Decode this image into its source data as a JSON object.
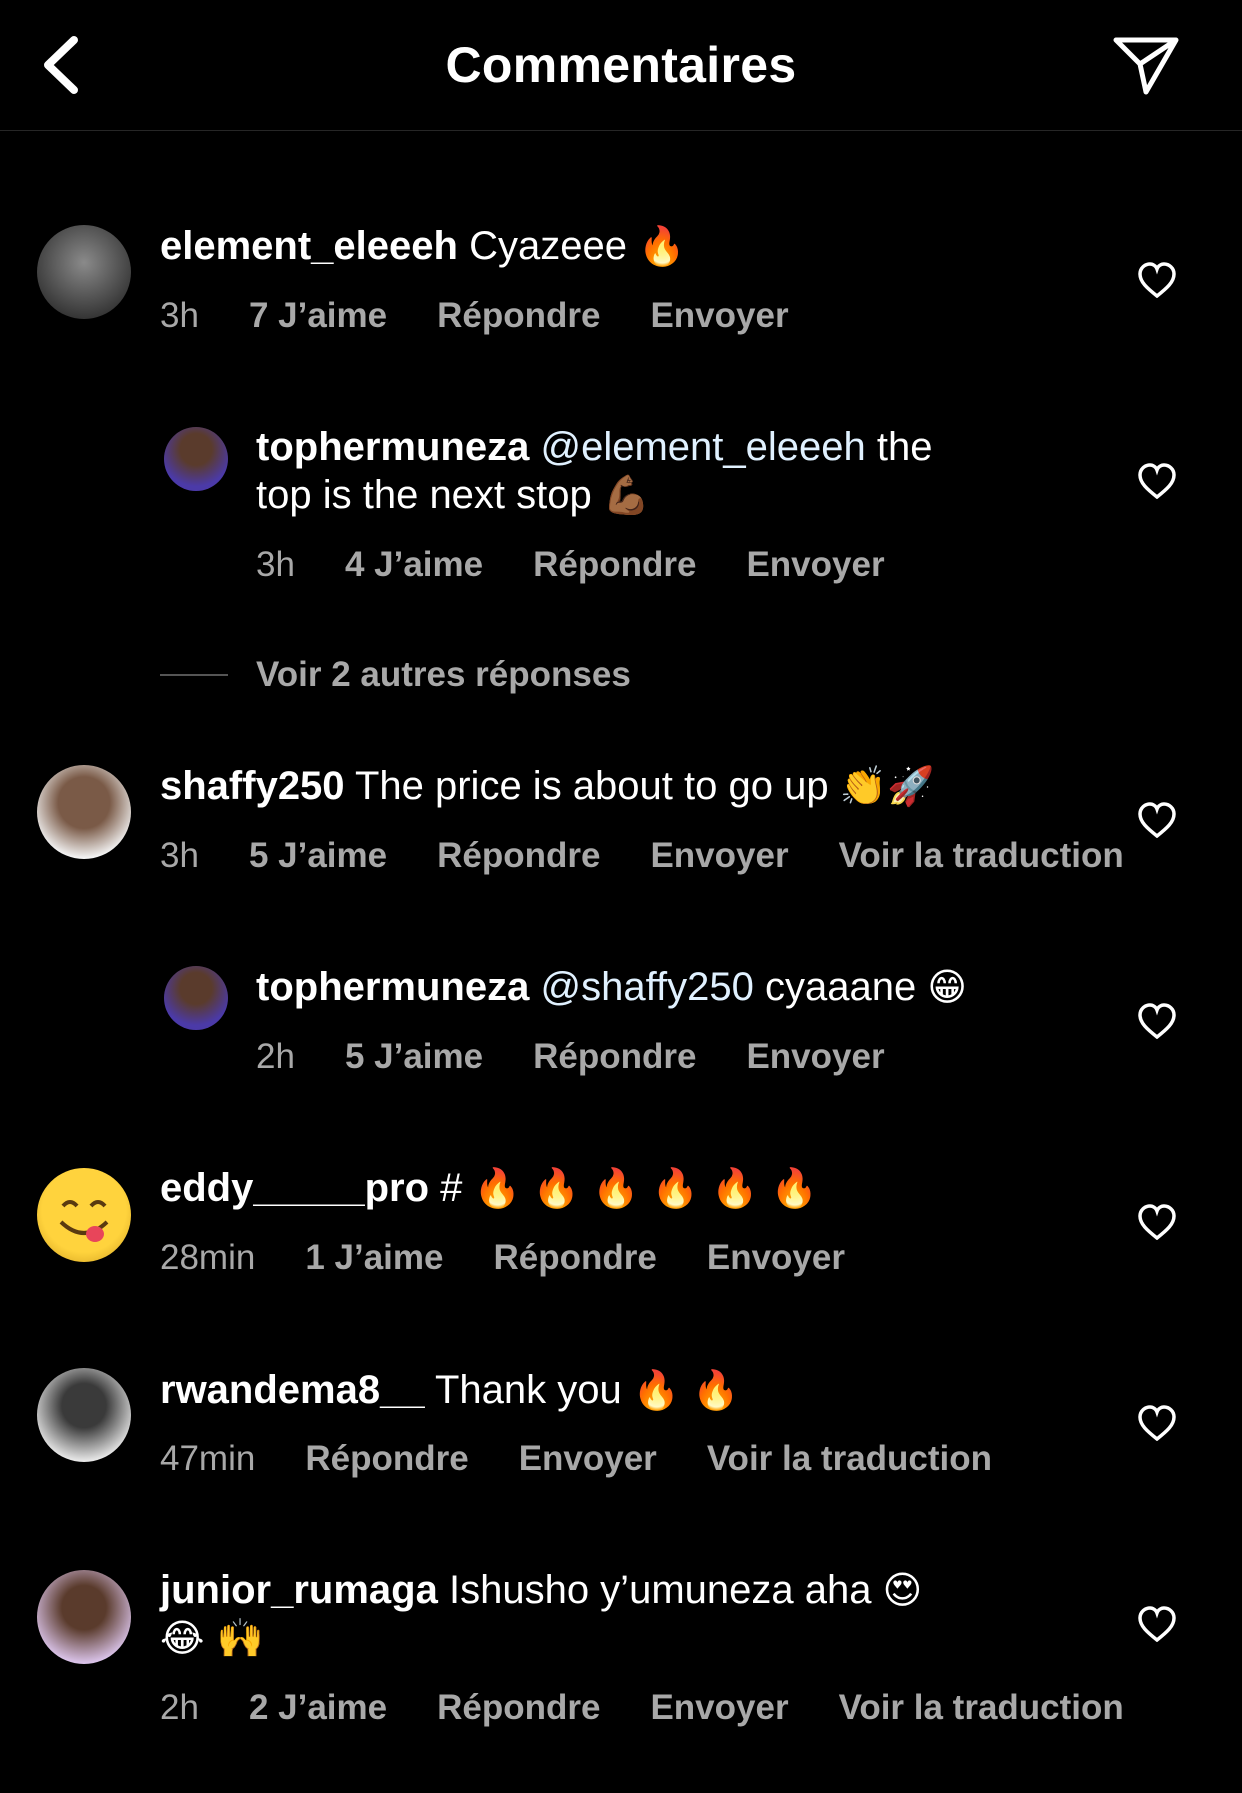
{
  "header": {
    "title": "Commentaires"
  },
  "colors": {
    "background": "#000000",
    "text": "#ffffff",
    "muted": "#a8a8a8",
    "mention": "#e0f1ff"
  },
  "comments": [
    {
      "username": "element_eleeeh",
      "text": "Cyazeee",
      "emojis": "🔥",
      "time": "3h",
      "likes": "7 J’aime",
      "reply": "Répondre",
      "send": "Envoyer"
    },
    {
      "username": "tophermuneza",
      "mention": "@element_eleeeh",
      "text": "the",
      "text2": "top is the next stop",
      "emojis": "💪🏾",
      "time": "3h",
      "likes": "4 J’aime",
      "reply": "Répondre",
      "send": "Envoyer"
    },
    {
      "username": "shaffy250",
      "text": "The price is about to go up",
      "emojis": "👏🚀",
      "time": "3h",
      "likes": "5 J’aime",
      "reply": "Répondre",
      "send": "Envoyer",
      "translate": "Voir la traduction"
    },
    {
      "username": "tophermuneza",
      "mention": "@shaffy250",
      "text": "cyaaane",
      "emojis": "😁",
      "time": "2h",
      "likes": "5 J’aime",
      "reply": "Répondre",
      "send": "Envoyer"
    },
    {
      "username": "eddy_____pro",
      "text": "#",
      "emojis": "🔥 🔥 🔥 🔥 🔥 🔥",
      "time": "28min",
      "likes": "1 J’aime",
      "reply": "Répondre",
      "send": "Envoyer"
    },
    {
      "username": "rwandema8__",
      "text": "Thank you",
      "emojis": "🔥 🔥",
      "time": "47min",
      "reply": "Répondre",
      "send": "Envoyer",
      "translate": "Voir la traduction"
    },
    {
      "username": "junior_rumaga",
      "text": "Ishusho y’umuneza aha",
      "emojis": "😍",
      "emojis2": "😂 🙌",
      "time": "2h",
      "likes": "2 J’aime",
      "reply": "Répondre",
      "send": "Envoyer",
      "translate": "Voir la traduction"
    }
  ],
  "more_replies": "Voir 2 autres réponses",
  "icons": {
    "back": "chevron-left-icon",
    "send": "paper-plane-icon",
    "like": "heart-outline-icon"
  }
}
